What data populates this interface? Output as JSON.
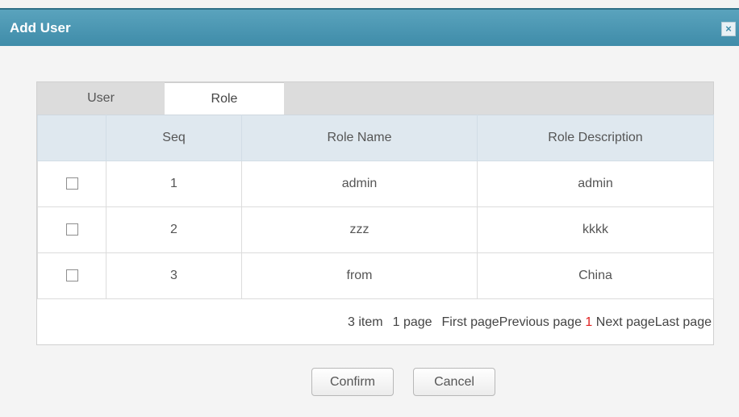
{
  "dialog": {
    "title": "Add User",
    "close_glyph": "×"
  },
  "tabs": [
    {
      "label": "User",
      "active": false
    },
    {
      "label": "Role",
      "active": true
    }
  ],
  "table": {
    "columns": [
      "",
      "Seq",
      "Role Name",
      "Role Description"
    ],
    "rows": [
      {
        "checked": false,
        "seq": "1",
        "role_name": "admin",
        "role_description": "admin"
      },
      {
        "checked": false,
        "seq": "2",
        "role_name": "zzz",
        "role_description": "kkkk"
      },
      {
        "checked": false,
        "seq": "3",
        "role_name": "from",
        "role_description": "China"
      }
    ]
  },
  "pager": {
    "items": "3 item",
    "pages": "1 page",
    "first": "First page",
    "previous": "Previous page",
    "current": "1",
    "next": "Next page",
    "last": "Last page",
    "current_color": "#e02020"
  },
  "buttons": {
    "confirm": "Confirm",
    "cancel": "Cancel"
  },
  "colors": {
    "title_bar": "#4596b3",
    "header_bg": "#dfe8ef"
  }
}
